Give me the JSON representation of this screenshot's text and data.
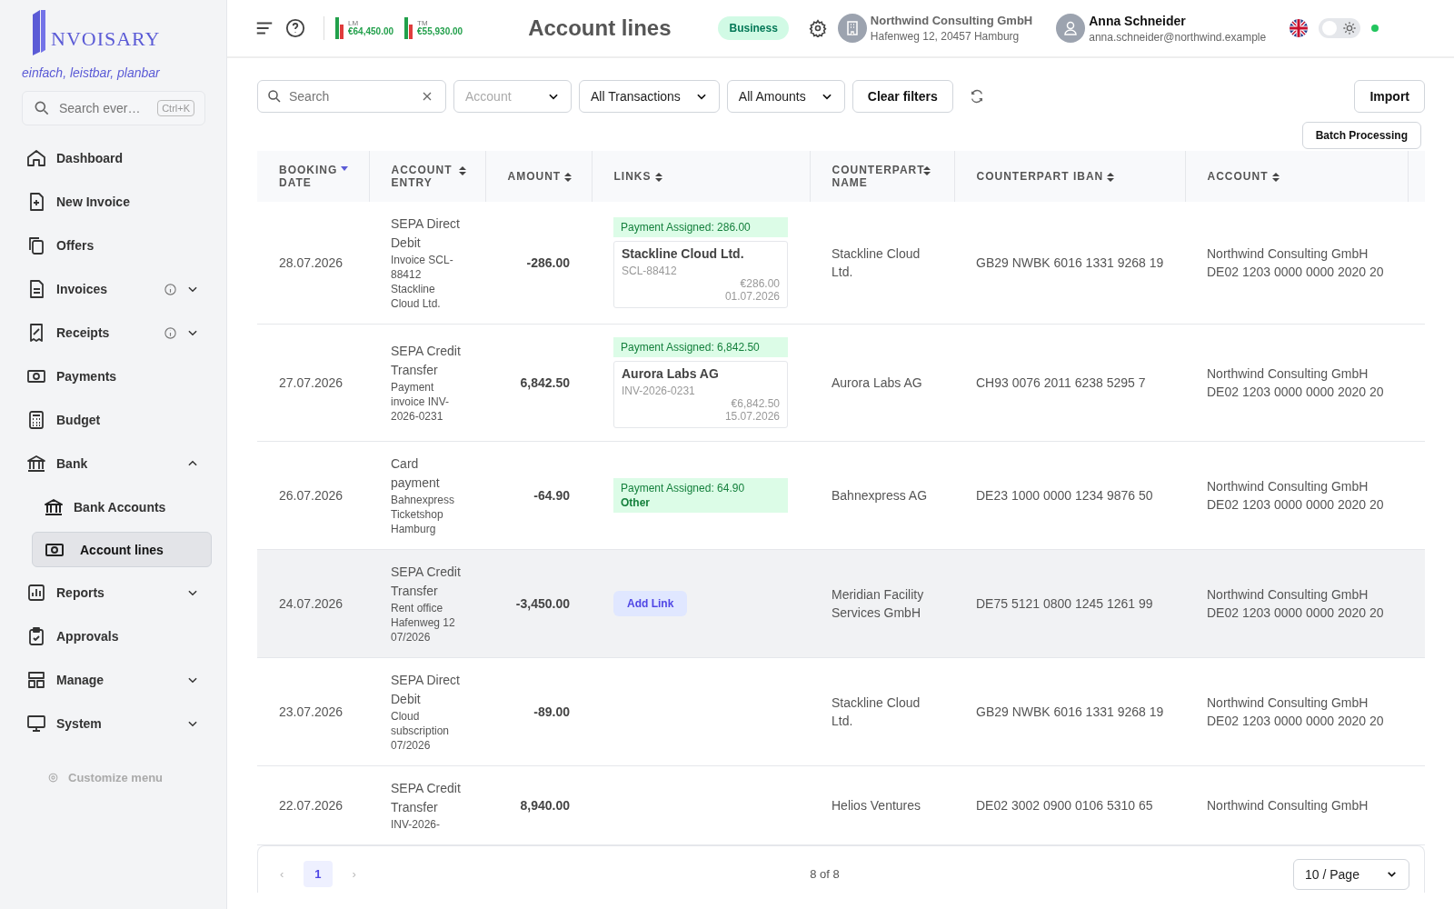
{
  "brand": {
    "logo_text": "NVOISARY",
    "tagline": "einfach, leistbar, planbar"
  },
  "sidebar": {
    "search": {
      "placeholder": "Search ever…",
      "shortcut": "Ctrl+K"
    },
    "items": [
      {
        "label": "Dashboard",
        "selected": false,
        "info": false
      },
      {
        "label": "New Invoice",
        "selected": false,
        "info": false
      },
      {
        "label": "Offers",
        "selected": false,
        "info": false
      },
      {
        "label": "Invoices",
        "selected": false,
        "info": true,
        "expanded": false
      },
      {
        "label": "Receipts",
        "selected": false,
        "info": true,
        "expanded": false
      },
      {
        "label": "Payments",
        "selected": false,
        "info": false
      },
      {
        "label": "Budget",
        "selected": false,
        "info": false
      },
      {
        "label": "Bank",
        "selected": false,
        "info": false,
        "expanded": true,
        "children": [
          {
            "label": "Bank Accounts",
            "selected": false
          },
          {
            "label": "Account lines",
            "selected": true
          }
        ]
      },
      {
        "label": "Reports",
        "selected": false,
        "info": false,
        "expanded": false
      },
      {
        "label": "Approvals",
        "selected": false,
        "info": false
      },
      {
        "label": "Manage",
        "selected": false,
        "info": false,
        "expanded": false
      },
      {
        "label": "System",
        "selected": false,
        "info": false,
        "expanded": false
      }
    ],
    "customize": "Customize menu"
  },
  "topbar": {
    "stats": [
      {
        "label": "LM",
        "value": "€64,450.00"
      },
      {
        "label": "TM",
        "value": "€55,930.00"
      }
    ],
    "title": "Account lines",
    "plan_badge": "Business",
    "company": {
      "name": "Northwind Consulting GmbH",
      "address": "Hafenweg 12, 20457 Hamburg"
    },
    "user": {
      "name": "Anna Schneider",
      "email": "anna.schneider@northwind.example"
    },
    "dark_mode": false,
    "online": true
  },
  "filters": {
    "search": {
      "placeholder": "Search"
    },
    "selects": [
      {
        "value": "Account",
        "placeholder": true
      },
      {
        "value": "All Transactions",
        "placeholder": false
      },
      {
        "value": "All Amounts",
        "placeholder": false
      }
    ],
    "clear": "Clear filters",
    "import": "Import",
    "batch": "Batch Processing"
  },
  "table": {
    "columns": [
      {
        "label": "BOOKING DATE",
        "sorted": true
      },
      {
        "label": "ACCOUNT ENTRY",
        "sorted": false
      },
      {
        "label": "AMOUNT",
        "sorted": false
      },
      {
        "label": "LINKS",
        "sorted": false
      },
      {
        "label": "COUNTERPART NAME",
        "sorted": false
      },
      {
        "label": "COUNTERPART IBAN",
        "sorted": false
      },
      {
        "label": "ACCOUNT",
        "sorted": false
      }
    ],
    "rows": [
      {
        "date": "28.07.2026",
        "entry_type": "SEPA Direct Debit",
        "entry_detail": "Invoice SCL-88412 Stackline Cloud Ltd.",
        "amount": "-286.00",
        "links": {
          "kind": "invoice",
          "badge": "Payment Assigned: 286.00",
          "name": "Stackline Cloud Ltd.",
          "ref": "SCL-88412",
          "amount": "€286.00",
          "date": "01.07.2026"
        },
        "counterpart": "Stackline Cloud Ltd.",
        "iban": "GB29 NWBK 6016 1331 9268 19",
        "account_name": "Northwind Consulting GmbH",
        "account_iban": "DE02 1203 0000 0000 2020 20",
        "selected": false
      },
      {
        "date": "27.07.2026",
        "entry_type": "SEPA Credit Transfer",
        "entry_detail": "Payment invoice INV-2026-0231",
        "amount": "6,842.50",
        "links": {
          "kind": "invoice",
          "badge": "Payment Assigned: 6,842.50",
          "name": "Aurora Labs AG",
          "ref": "INV-2026-0231",
          "amount": "€6,842.50",
          "date": "15.07.2026"
        },
        "counterpart": "Aurora Labs AG",
        "iban": "CH93 0076 2011 6238 5295 7",
        "account_name": "Northwind Consulting GmbH",
        "account_iban": "DE02 1203 0000 0000 2020 20",
        "selected": false
      },
      {
        "date": "26.07.2026",
        "entry_type": "Card payment",
        "entry_detail": "Bahnexpress Ticketshop Hamburg",
        "amount": "-64.90",
        "links": {
          "kind": "other",
          "badge": "Payment Assigned: 64.90",
          "other": "Other"
        },
        "counterpart": "Bahnexpress AG",
        "iban": "DE23 1000 0000 1234 9876 50",
        "account_name": "Northwind Consulting GmbH",
        "account_iban": "DE02 1203 0000 0000 2020 20",
        "selected": false
      },
      {
        "date": "24.07.2026",
        "entry_type": "SEPA Credit Transfer",
        "entry_detail": "Rent office Hafenweg 12 07/2026",
        "amount": "-3,450.00",
        "links": {
          "kind": "add",
          "button": "Add Link"
        },
        "counterpart": "Meridian Facility Services GmbH",
        "iban": "DE75 5121 0800 1245 1261 99",
        "account_name": "Northwind Consulting GmbH",
        "account_iban": "DE02 1203 0000 0000 2020 20",
        "selected": true
      },
      {
        "date": "23.07.2026",
        "entry_type": "SEPA Direct Debit",
        "entry_detail": "Cloud subscription 07/2026",
        "amount": "-89.00",
        "links": {
          "kind": "none"
        },
        "counterpart": "Stackline Cloud Ltd.",
        "iban": "GB29 NWBK 6016 1331 9268 19",
        "account_name": "Northwind Consulting GmbH",
        "account_iban": "DE02 1203 0000 0000 2020 20",
        "selected": false
      },
      {
        "date": "22.07.2026",
        "entry_type": "SEPA Credit Transfer",
        "entry_detail": "INV-2026-",
        "amount": "8,940.00",
        "links": {
          "kind": "none"
        },
        "counterpart": "Helios Ventures",
        "iban": "DE02 3002 0900 0106 5310 65",
        "account_name": "Northwind Consulting GmbH",
        "selected": false
      }
    ]
  },
  "pagination": {
    "pages": [
      {
        "label": "1",
        "selected": true
      }
    ],
    "prev": "‹",
    "next": "›",
    "summary": "8 of 8",
    "page_size": "10 / Page"
  }
}
